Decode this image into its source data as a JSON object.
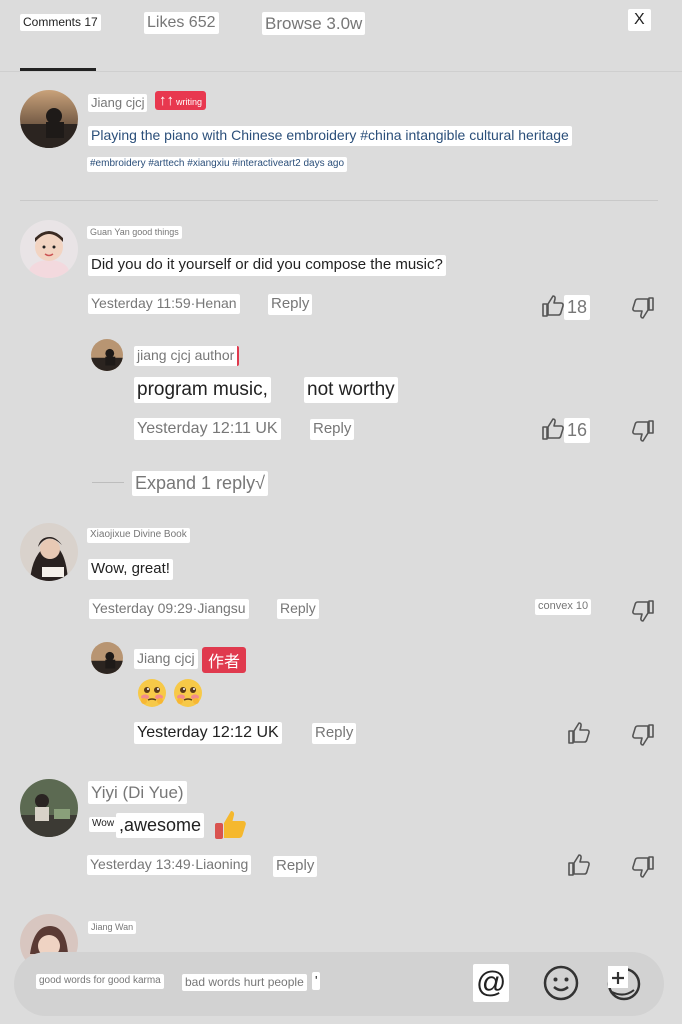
{
  "header": {
    "tabs": [
      {
        "label": "Comments 17"
      },
      {
        "label": "Likes 652"
      },
      {
        "label": "Browse 3.0w"
      }
    ],
    "close_label": "X"
  },
  "post": {
    "author": "Jiang cjcj",
    "badge_big": "↑↑",
    "badge_text": "writing",
    "title": "Playing the piano with Chinese embroidery #china intangible cultural heritage",
    "tags_and_time": "#embroidery #arttech #xiangxiu #interactiveart2 days ago"
  },
  "comments": [
    {
      "author": "Guan Yan good things",
      "text": "Did you do it yourself or did you compose the music?",
      "meta": "Yesterday 11:59·Henan",
      "reply_label": "Reply",
      "likes": "18",
      "reply": {
        "author": "jiang cjcj author",
        "text_part1": "program music,",
        "text_part2": "not worthy",
        "meta": "Yesterday 12:11 UK",
        "reply_label": "Reply",
        "likes": "16"
      },
      "expand_label": "Expand 1 reply√"
    },
    {
      "author": "Xiaojixue Divine Book",
      "text": "Wow, great!",
      "meta": "Yesterday 09:29·Jiangsu",
      "reply_label": "Reply",
      "likes": "convex 10",
      "reply": {
        "author": "Jiang cjcj",
        "author_badge": "作者",
        "meta": "Yesterday 12:12 UK",
        "reply_label": "Reply"
      }
    },
    {
      "author": "Yiyi (Di Yue)",
      "text_small": "Wow",
      "text_big": ",awesome",
      "meta": "Yesterday 13:49·Liaoning",
      "reply_label": "Reply"
    },
    {
      "author": "Jiang Wan"
    }
  ],
  "input_bar": {
    "hint1": "good words for good karma",
    "hint2": "bad words hurt people",
    "hint3": "'",
    "at_label": "@"
  }
}
